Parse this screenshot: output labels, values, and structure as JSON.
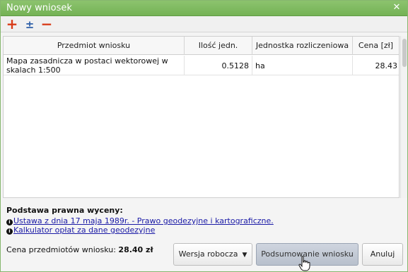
{
  "window": {
    "title": "Nowy wniosek",
    "close_glyph": "✕"
  },
  "toolbar": {
    "add_glyph": "+",
    "plus_minus_glyph": "±",
    "remove_glyph": "−"
  },
  "grid": {
    "headers": [
      "Przedmiot wniosku",
      "Ilość jedn.",
      "Jednostka rozliczeniowa",
      "Cena [zł]"
    ],
    "rows": [
      {
        "item": "Mapa zasadnicza w postaci wektorowej w skalach 1:500",
        "quantity": "0.5128",
        "unit": "ha",
        "price": "28.43"
      }
    ]
  },
  "legal": {
    "title": "Podstawa prawna wyceny:",
    "links": [
      "Ustawa z dnia 17 maja 1989r. - Prawo geodezyjne i kartograficzne.",
      "Kalkulator opłat za dane geodezyjne"
    ]
  },
  "footer": {
    "total_label": "Cena przedmiotów wniosku:",
    "total_value": "28.40 zł",
    "draft_label": "Wersja robocza",
    "summary_label": "Podsumowanie wniosku",
    "cancel_label": "Anuluj"
  },
  "colors": {
    "titlebar": "#7cb65d",
    "accent_red": "#d83a17",
    "accent_blue": "#2e5fa8",
    "link": "#1a1aa6"
  },
  "icons": {
    "close": "close-icon",
    "add": "add-icon",
    "plus_minus": "plus-minus-icon",
    "remove": "remove-icon",
    "info": "info-icon",
    "dropdown": "chevron-down-icon"
  }
}
